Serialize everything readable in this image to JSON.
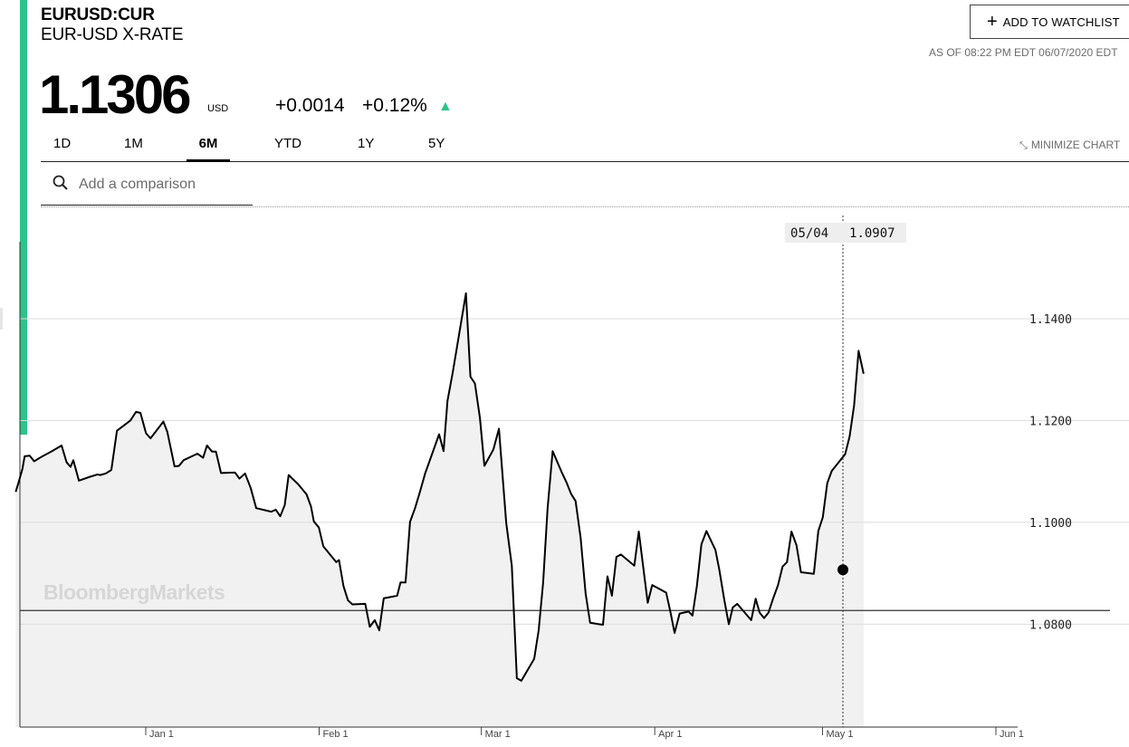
{
  "header": {
    "ticker": "EURUSD:CUR",
    "name": "EUR-USD X-RATE",
    "watchlist_label": "ADD TO WATCHLIST",
    "as_of": "AS OF 08:22 PM EDT 06/07/2020 EDT"
  },
  "quote": {
    "price": "1.1306",
    "currency": "USD",
    "change": "+0.0014",
    "change_pct": "+0.12%",
    "direction_icon": "triangle-up",
    "up_color": "#2bc48a"
  },
  "tabs": [
    {
      "label": "1D",
      "active": false
    },
    {
      "label": "1M",
      "active": false
    },
    {
      "label": "6M",
      "active": true
    },
    {
      "label": "YTD",
      "active": false
    },
    {
      "label": "1Y",
      "active": false
    },
    {
      "label": "5Y",
      "active": false
    }
  ],
  "minimize_label": "MINIMIZE CHART",
  "search": {
    "placeholder": "Add a comparison"
  },
  "brand": "BloombergMarkets",
  "chart_data": {
    "type": "area",
    "title": "",
    "xlabel": "",
    "ylabel": "",
    "ylim": [
      1.0598,
      1.148
    ],
    "yticks": [
      1.08,
      1.1,
      1.12,
      1.14
    ],
    "ytick_labels": [
      "1.0800",
      "1.1000",
      "1.1200",
      "1.1400"
    ],
    "xticks": [
      {
        "day": 13,
        "label": "Jan 1"
      },
      {
        "day": 44,
        "label": "Feb 1"
      },
      {
        "day": 73,
        "label": "Mar 1"
      },
      {
        "day": 104,
        "label": "Apr 1"
      },
      {
        "day": 134,
        "label": "May 1"
      },
      {
        "day": 165,
        "label": "Jun 1"
      }
    ],
    "baseline": 1.0827,
    "hover": {
      "day": 137,
      "date_label": "05/04",
      "value_label": "1.0907",
      "value": 1.0907
    },
    "series": [
      {
        "values": [
          [
            -10.9,
            1.106
          ],
          [
            -10.4,
            1.1078
          ],
          [
            -9.7,
            1.1105
          ],
          [
            -9.3,
            1.113
          ],
          [
            -8.4,
            1.1131
          ],
          [
            -7.6,
            1.112
          ],
          [
            -6.1,
            1.113
          ],
          [
            -4.4,
            1.114
          ],
          [
            -2.7,
            1.1151
          ],
          [
            -1.8,
            1.1118
          ],
          [
            -1.1,
            1.1109
          ],
          [
            -0.6,
            1.1122
          ],
          [
            0.4,
            1.1082
          ],
          [
            2.2,
            1.1089
          ],
          [
            3.7,
            1.1094
          ],
          [
            4.2,
            1.1093
          ],
          [
            5.2,
            1.1096
          ],
          [
            6.2,
            1.1103
          ],
          [
            7.2,
            1.118
          ],
          [
            9.6,
            1.12
          ],
          [
            10.6,
            1.1217
          ],
          [
            11.4,
            1.1215
          ],
          [
            12.4,
            1.1175
          ],
          [
            13.2,
            1.1165
          ],
          [
            15.5,
            1.1198
          ],
          [
            16.2,
            1.1178
          ],
          [
            17.5,
            1.111
          ],
          [
            18.3,
            1.1111
          ],
          [
            19.1,
            1.1122
          ],
          [
            21.6,
            1.1135
          ],
          [
            22.6,
            1.1127
          ],
          [
            23.3,
            1.1151
          ],
          [
            24.2,
            1.1139
          ],
          [
            24.9,
            1.1139
          ],
          [
            25.8,
            1.1097
          ],
          [
            28.3,
            1.1098
          ],
          [
            29.1,
            1.1086
          ],
          [
            30.1,
            1.1096
          ],
          [
            31.1,
            1.1068
          ],
          [
            32.1,
            1.1028
          ],
          [
            34.8,
            1.1021
          ],
          [
            35.6,
            1.1025
          ],
          [
            36.4,
            1.1012
          ],
          [
            37.2,
            1.1034
          ],
          [
            37.9,
            1.1093
          ],
          [
            39.6,
            1.1075
          ],
          [
            41.1,
            1.1055
          ],
          [
            41.9,
            1.1031
          ],
          [
            42.4,
            1.1002
          ],
          [
            43.3,
            1.099
          ],
          [
            44.1,
            1.0953
          ],
          [
            46.4,
            1.0922
          ],
          [
            46.9,
            1.0926
          ],
          [
            47.7,
            1.0875
          ],
          [
            48.5,
            1.0847
          ],
          [
            49.3,
            1.0839
          ],
          [
            51.6,
            1.084
          ],
          [
            52.4,
            1.0795
          ],
          [
            53.3,
            1.0808
          ],
          [
            54.1,
            1.0788
          ],
          [
            54.9,
            1.0851
          ],
          [
            56.4,
            1.0854
          ],
          [
            57.3,
            1.0856
          ],
          [
            57.9,
            1.0882
          ],
          [
            58.8,
            1.0882
          ],
          [
            59.6,
            1.1001
          ],
          [
            60.5,
            1.1028
          ],
          [
            61.4,
            1.1061
          ],
          [
            62.3,
            1.1096
          ],
          [
            64.8,
            1.1173
          ],
          [
            65.6,
            1.114
          ],
          [
            66.3,
            1.1239
          ],
          [
            67.2,
            1.1292
          ],
          [
            69.6,
            1.145
          ],
          [
            70.4,
            1.1286
          ],
          [
            71.2,
            1.1273
          ],
          [
            72.1,
            1.1205
          ],
          [
            72.9,
            1.1111
          ],
          [
            74.5,
            1.1143
          ],
          [
            75.5,
            1.1184
          ],
          [
            76.8,
            1.0999
          ],
          [
            77.8,
            1.0915
          ],
          [
            78.7,
            1.0694
          ],
          [
            79.5,
            1.0689
          ],
          [
            81.8,
            1.0732
          ],
          [
            82.6,
            1.0788
          ],
          [
            83.4,
            1.0882
          ],
          [
            84.2,
            1.1028
          ],
          [
            85.1,
            1.114
          ],
          [
            86.7,
            1.1099
          ],
          [
            87.6,
            1.1078
          ],
          [
            88.4,
            1.1056
          ],
          [
            89.2,
            1.1042
          ],
          [
            90.1,
            1.097
          ],
          [
            91.0,
            1.086
          ],
          [
            91.8,
            1.0803
          ],
          [
            93.4,
            1.08
          ],
          [
            94.1,
            1.0799
          ],
          [
            94.9,
            1.0894
          ],
          [
            95.7,
            1.0856
          ],
          [
            96.5,
            1.0932
          ],
          [
            97.3,
            1.0937
          ],
          [
            99.7,
            1.0915
          ],
          [
            100.5,
            1.0982
          ],
          [
            102.1,
            1.0842
          ],
          [
            102.9,
            1.0877
          ],
          [
            105.4,
            1.0862
          ],
          [
            106.2,
            1.0822
          ],
          [
            106.9,
            1.0783
          ],
          [
            107.8,
            1.0821
          ],
          [
            109.4,
            1.0825
          ],
          [
            110.1,
            1.0817
          ],
          [
            110.9,
            1.0876
          ],
          [
            111.7,
            1.0957
          ],
          [
            112.6,
            1.0983
          ],
          [
            114.2,
            1.0946
          ],
          [
            114.9,
            1.0907
          ],
          [
            115.8,
            1.0847
          ],
          [
            116.6,
            1.08
          ],
          [
            117.3,
            1.0833
          ],
          [
            118.1,
            1.084
          ],
          [
            120.6,
            1.0808
          ],
          [
            121.4,
            1.085
          ],
          [
            122.1,
            1.0823
          ],
          [
            122.9,
            1.0812
          ],
          [
            123.7,
            1.0823
          ],
          [
            124.5,
            1.085
          ],
          [
            125.4,
            1.0877
          ],
          [
            126.2,
            1.0913
          ],
          [
            127.0,
            1.0922
          ],
          [
            127.8,
            1.0982
          ],
          [
            128.7,
            1.0955
          ],
          [
            129.5,
            1.0902
          ],
          [
            131.8,
            1.0899
          ],
          [
            132.6,
            1.0983
          ],
          [
            133.4,
            1.101
          ],
          [
            134.2,
            1.1077
          ],
          [
            135.0,
            1.1101
          ],
          [
            136.6,
            1.1123
          ],
          [
            137.4,
            1.1134
          ],
          [
            138.2,
            1.1169
          ],
          [
            139.0,
            1.123
          ],
          [
            139.8,
            1.1337
          ],
          [
            140.7,
            1.1292
          ]
        ]
      }
    ]
  }
}
